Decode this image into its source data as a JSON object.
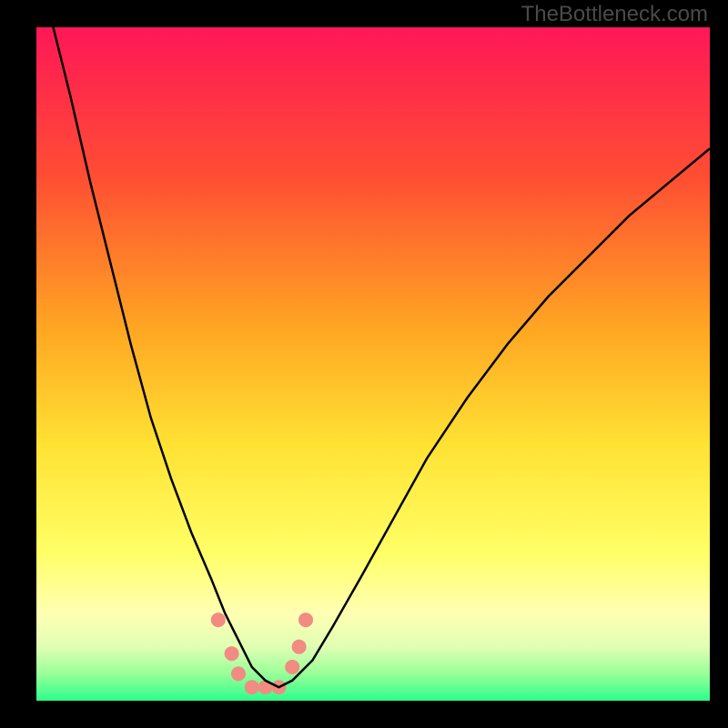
{
  "watermark": "TheBottleneck.com",
  "chart_data": {
    "type": "line",
    "title": "",
    "xlabel": "",
    "ylabel": "",
    "xlim": [
      0,
      100
    ],
    "ylim": [
      0,
      100
    ],
    "gradient_stops": [
      {
        "offset": 0,
        "color": "#ff1757"
      },
      {
        "offset": 0.22,
        "color": "#ff4d33"
      },
      {
        "offset": 0.45,
        "color": "#ffa722"
      },
      {
        "offset": 0.62,
        "color": "#ffe233"
      },
      {
        "offset": 0.78,
        "color": "#ffff66"
      },
      {
        "offset": 0.87,
        "color": "#ffffb3"
      },
      {
        "offset": 0.92,
        "color": "#e0ffb3"
      },
      {
        "offset": 0.96,
        "color": "#99ff99"
      },
      {
        "offset": 1.0,
        "color": "#2bff8a"
      }
    ],
    "series": [
      {
        "name": "bottleneck-curve",
        "x": [
          0,
          2,
          5,
          8,
          11,
          14,
          17,
          20,
          23,
          26,
          28,
          30,
          32,
          34,
          36,
          38,
          41,
          44,
          48,
          53,
          58,
          64,
          70,
          76,
          82,
          88,
          94,
          100
        ],
        "y": [
          110,
          102,
          90,
          77,
          65,
          53,
          42,
          33,
          25,
          18,
          13,
          9,
          5,
          3,
          2,
          3,
          6,
          11,
          18,
          27,
          36,
          45,
          53,
          60,
          66,
          72,
          77,
          82
        ]
      }
    ],
    "markers": {
      "name": "bottleneck-points",
      "x": [
        27,
        29,
        30,
        32,
        34,
        36,
        38,
        39,
        40
      ],
      "y": [
        12,
        7,
        4,
        2,
        2,
        2,
        5,
        8,
        12
      ],
      "color": "#f28b82",
      "radius": 8
    }
  }
}
